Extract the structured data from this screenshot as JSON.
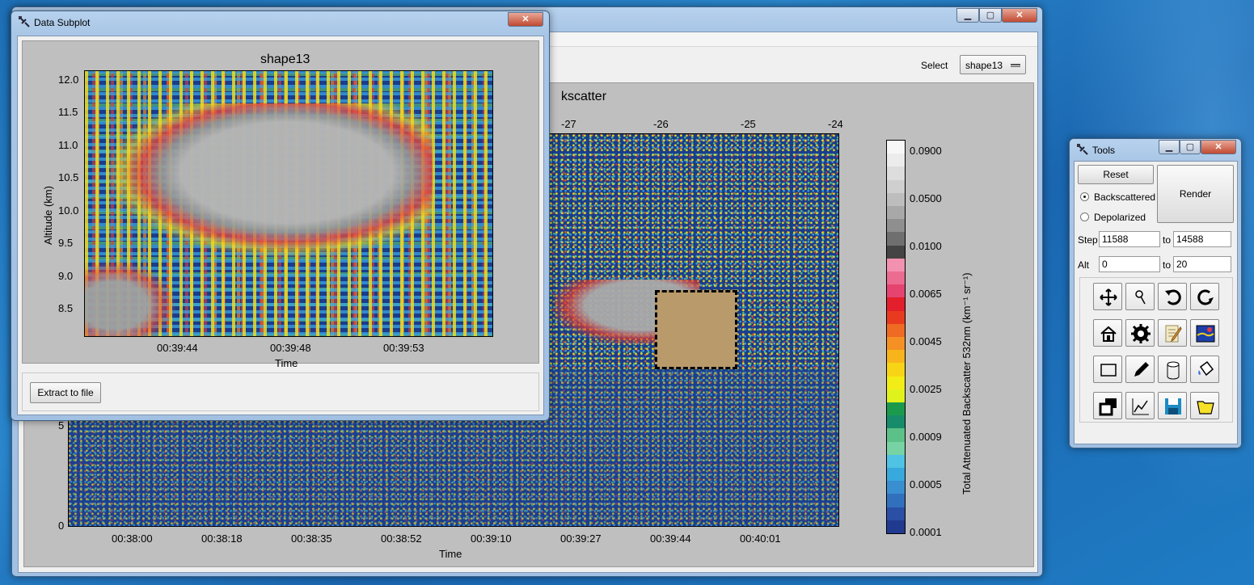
{
  "main_window": {
    "title": "",
    "select_label": "Select",
    "select_value": "shape13",
    "plot_title_fragment": "kscatter",
    "x_top_ticks": [
      "-27",
      "-26",
      "-25",
      "-24"
    ],
    "x_bottom_ticks": [
      "00:38:00",
      "00:38:18",
      "00:38:35",
      "00:38:52",
      "00:39:10",
      "00:39:27",
      "00:39:44",
      "00:40:01"
    ],
    "y_ticks": [
      "5",
      "0"
    ],
    "xlabel": "Time",
    "colorbar_label": "Total Attenuated Backscatter 532nm (km⁻¹ sr⁻¹)",
    "colorbar_ticks": [
      "0.0900",
      "0.0500",
      "0.0100",
      "0.0065",
      "0.0045",
      "0.0025",
      "0.0009",
      "0.0005",
      "0.0001"
    ],
    "colorbar_colors": [
      "#f7f7f7",
      "#ececec",
      "#dddddd",
      "#cfcfcf",
      "#bdbdbd",
      "#a8a8a8",
      "#8f8f8f",
      "#6f6f6f",
      "#444444",
      "#f291b0",
      "#ec6b91",
      "#e64470",
      "#e21f2b",
      "#e83a1f",
      "#ef6a22",
      "#f59024",
      "#f8b51b",
      "#f7d516",
      "#f2ec17",
      "#dff21c",
      "#1c9a4c",
      "#178c6a",
      "#5cc189",
      "#77d3a3",
      "#4fc3e3",
      "#37a9dd",
      "#3a8fd0",
      "#3170bd",
      "#2a4fa5",
      "#1f3a8f"
    ],
    "shape_fill": "#b99a6b"
  },
  "subplot_window": {
    "title": "Data Subplot",
    "plot_title": "shape13",
    "y_ticks": [
      "12.0",
      "11.5",
      "11.0",
      "10.5",
      "10.0",
      "9.5",
      "9.0",
      "8.5"
    ],
    "x_ticks": [
      "00:39:44",
      "00:39:48",
      "00:39:53"
    ],
    "ylabel": "Altitude (km)",
    "xlabel": "Time",
    "extract_button": "Extract to file"
  },
  "tools_window": {
    "title": "Tools",
    "reset_label": "Reset",
    "render_label": "Render",
    "radio_backscattered": "Backscattered",
    "radio_depolarized": "Depolarized",
    "selected_radio": "Backscattered",
    "step_label": "Step",
    "step_from": "11588",
    "step_to_label": "to",
    "step_to": "14588",
    "alt_label": "Alt",
    "alt_from": "0",
    "alt_to_label": "to",
    "alt_to": "20",
    "tool_icons": [
      "pan-icon",
      "zoom-icon",
      "undo-icon",
      "redo-icon",
      "home-icon",
      "settings-gear-icon",
      "notepad-icon",
      "plot-image-icon",
      "rectangle-icon",
      "pencil-icon",
      "cylinder-icon",
      "paint-bucket-icon",
      "layers-icon",
      "line-chart-icon",
      "save-disk-icon",
      "open-folder-icon"
    ]
  }
}
